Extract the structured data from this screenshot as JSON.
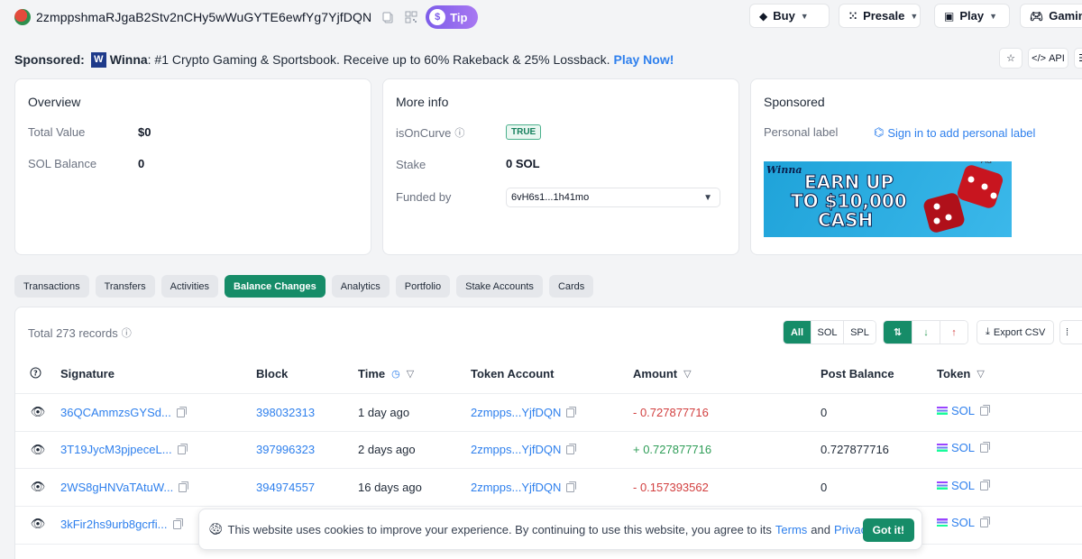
{
  "header": {
    "address": "2zmppshmaRJgaB2Stv2nCHy5wWuGYTE6ewfYg7YjfDQN",
    "tip_label": "Tip",
    "nav": [
      {
        "label": "Buy",
        "icon": "tag-icon"
      },
      {
        "label": "Presale",
        "icon": "grid-icon"
      },
      {
        "label": "Play",
        "icon": "monitor-icon"
      },
      {
        "label": "Gaming",
        "icon": "gamepad-icon"
      }
    ]
  },
  "sponsored_line": {
    "prefix": "Sponsored:",
    "brand": "Winna",
    "brand_logo_letter": "W",
    "text": ": #1 Crypto Gaming & Sportsbook. Receive up to 60% Rakeback & 25% Lossback.",
    "cta": "Play Now!",
    "api_label": "API"
  },
  "overview": {
    "title": "Overview",
    "rows": [
      {
        "label": "Total Value",
        "value": "$0"
      },
      {
        "label": "SOL Balance",
        "value": "0"
      }
    ]
  },
  "more_info": {
    "title": "More info",
    "is_on_curve_label": "isOnCurve",
    "is_on_curve_value": "TRUE",
    "stake_label": "Stake",
    "stake_value": "0 SOL",
    "funded_by_label": "Funded by",
    "funded_by_value": "6vH6s1...1h41mo"
  },
  "sponsored_card": {
    "title": "Sponsored",
    "personal_label": "Personal label",
    "sign_in_link": "Sign in to add personal label",
    "ad_tag": "Ad",
    "ad_brand": "Winna",
    "ad_line1": "EARN UP",
    "ad_line2": "TO $10,000",
    "ad_line3": "CASH"
  },
  "tabs": [
    {
      "label": "Transactions",
      "active": false
    },
    {
      "label": "Transfers",
      "active": false
    },
    {
      "label": "Activities",
      "active": false
    },
    {
      "label": "Balance Changes",
      "active": true
    },
    {
      "label": "Analytics",
      "active": false
    },
    {
      "label": "Portfolio",
      "active": false
    },
    {
      "label": "Stake Accounts",
      "active": false
    },
    {
      "label": "Cards",
      "active": false
    }
  ],
  "table": {
    "total_records": "Total 273 records",
    "filters": [
      "All",
      "SOL",
      "SPL"
    ],
    "export_label": "Export CSV",
    "columns": {
      "signature": "Signature",
      "block": "Block",
      "time": "Time",
      "token_account": "Token Account",
      "amount": "Amount",
      "post_balance": "Post Balance",
      "token": "Token"
    },
    "rows": [
      {
        "signature": "36QCAmmzsGYSd...",
        "block": "398032313",
        "time": "1 day ago",
        "token_account": "2zmpps...YjfDQN",
        "amount": "- 0.727877716",
        "post_balance": "0",
        "token": "SOL"
      },
      {
        "signature": "3T19JycM3pjpeceL...",
        "block": "397996323",
        "time": "2 days ago",
        "token_account": "2zmpps...YjfDQN",
        "amount": "+ 0.727877716",
        "post_balance": "0.727877716",
        "token": "SOL"
      },
      {
        "signature": "2WS8gHNVaTAtuW...",
        "block": "394974557",
        "time": "16 days ago",
        "token_account": "2zmpps...YjfDQN",
        "amount": "- 0.157393562",
        "post_balance": "0",
        "token": "SOL"
      },
      {
        "signature": "3kFir2hs9urb8gcrfi...",
        "block": "",
        "time": "",
        "token_account": "",
        "amount": "",
        "post_balance": "",
        "token": "SOL"
      }
    ]
  },
  "cookie": {
    "text": "This website uses cookies to improve your experience. By continuing to use this website, you agree to its",
    "terms": "Terms",
    "and": "and",
    "privacy": "Privacy Policy",
    "period": ".",
    "button": "Got it!"
  },
  "colors": {
    "accent": "#168c68",
    "link": "#2f80ed",
    "negative": "#d23f3f",
    "positive": "#2e9d57"
  }
}
